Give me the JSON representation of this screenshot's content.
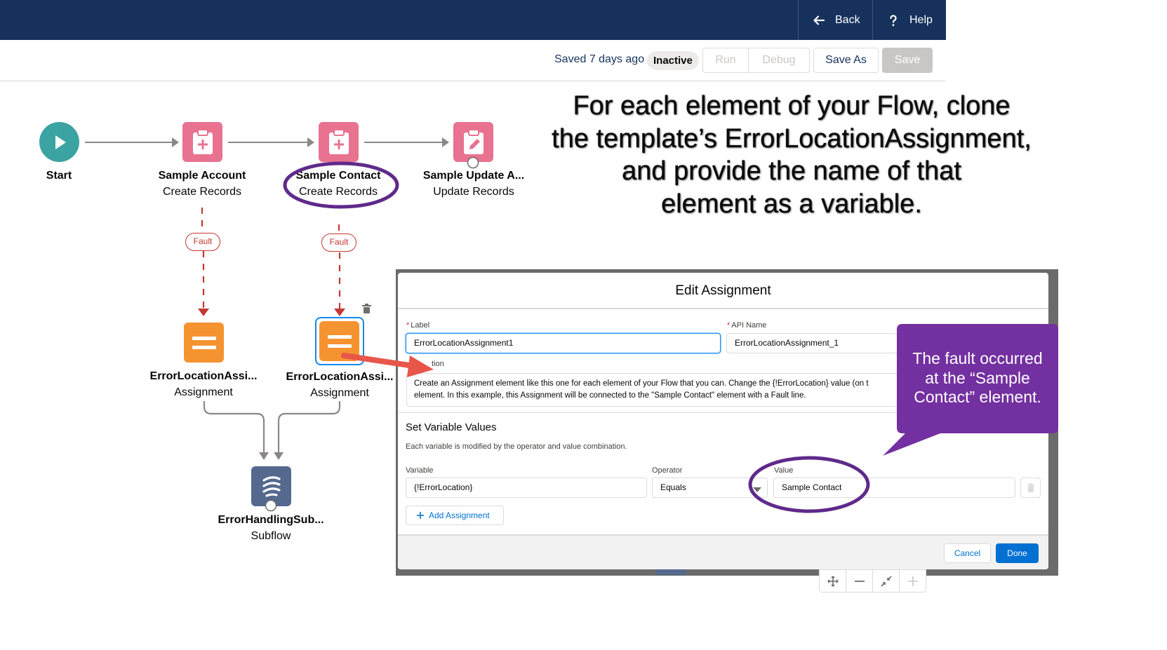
{
  "header": {
    "back_label": "Back",
    "help_label": "Help",
    "background_color": "#16325c"
  },
  "toolbar": {
    "saved_text": "Saved 7 days ago",
    "status_badge": "Inactive",
    "run_label": "Run",
    "debug_label": "Debug",
    "save_as_label": "Save As",
    "save_label": "Save"
  },
  "canvas": {
    "nodes": [
      {
        "title": "Start",
        "subtitle": "",
        "icon": "play-icon",
        "color": "#3ba4a2"
      },
      {
        "title": "Sample Account",
        "subtitle": "Create Records",
        "icon": "create-records-icon",
        "color": "#e87290"
      },
      {
        "title": "Sample Contact",
        "subtitle": "Create Records",
        "icon": "create-records-icon",
        "color": "#e87290"
      },
      {
        "title": "Sample Update A...",
        "subtitle": "Update Records",
        "icon": "update-records-icon",
        "color": "#e87290"
      },
      {
        "title": "ErrorLocationAssi...",
        "subtitle": "Assignment",
        "icon": "assignment-icon",
        "color": "#f59331"
      },
      {
        "title": "ErrorLocationAssi...",
        "subtitle": "Assignment",
        "icon": "assignment-icon",
        "color": "#f59331"
      },
      {
        "title": "ErrorHandlingSub...",
        "subtitle": "Subflow",
        "icon": "subflow-icon",
        "color": "#54698d"
      }
    ],
    "fault_label": "Fault",
    "fault_color": "#c23934"
  },
  "annotation": {
    "headline_lines": [
      "For each element of your Flow, clone",
      "the template’s ErrorLocationAssignment,",
      "and provide the name of that",
      "element as a variable."
    ],
    "callout_lines": [
      "The fault occurred",
      "at the “Sample",
      "Contact” element."
    ],
    "callout_color": "#7330a0",
    "highlight_color": "#5f2a8a",
    "arrow_color": "#e8564a"
  },
  "modal": {
    "title": "Edit Assignment",
    "label_field": {
      "label": "Label",
      "value": "ErrorLocationAssignment1"
    },
    "api_name_field": {
      "label": "API Name",
      "value": "ErrorLocationAssignment_1"
    },
    "description_label": "tion",
    "description_lines": [
      "Create an Assignment element like this one for each element of your Flow that you can. Change the {!ErrorLocation} value (on t",
      "element. In this example, this Assignment will be connected to the \"Sample Contact\" element with a Fault line."
    ],
    "section_title": "Set Variable Values",
    "section_subtitle": "Each variable is modified by the operator and value combination.",
    "variable_label": "Variable",
    "variable_value": "{!ErrorLocation}",
    "operator_label": "Operator",
    "operator_value": "Equals",
    "value_label": "Value",
    "value_value": "Sample Contact",
    "add_assignment_label": "Add Assignment",
    "cancel_label": "Cancel",
    "done_label": "Done"
  }
}
